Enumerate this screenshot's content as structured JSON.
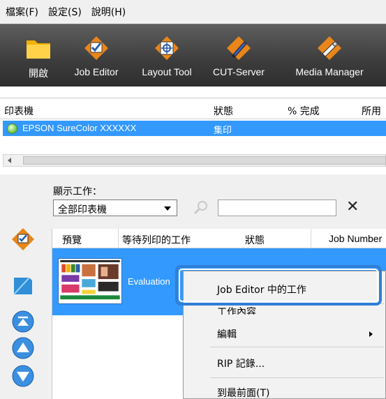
{
  "menubar": {
    "items": [
      "檔案(F)",
      "設定(S)",
      "說明(H)"
    ]
  },
  "toolbar": {
    "buttons": [
      {
        "label": "開啟",
        "icon": "folder-icon"
      },
      {
        "label": "Job Editor",
        "icon": "job-editor-icon"
      },
      {
        "label": "Layout Tool",
        "icon": "layout-tool-icon"
      },
      {
        "label": "CUT-Server",
        "icon": "cut-server-icon"
      },
      {
        "label": "Media Manager",
        "icon": "media-manager-icon"
      }
    ]
  },
  "printers": {
    "columns": [
      "印表機",
      "狀態",
      "% 完成",
      "所用"
    ],
    "rows": [
      {
        "name": "EPSON SureColor XXXXXX",
        "status": "集印"
      }
    ]
  },
  "jobs_panel": {
    "show_label": "顯示工作：",
    "filter_value": "全部印表機",
    "search_placeholder": "",
    "clear_symbol": "✕",
    "columns": [
      "預覽",
      "等待列印的工作",
      "狀態",
      "Job Number"
    ],
    "rows": [
      {
        "name": "Evaluation"
      }
    ]
  },
  "context_menu": {
    "items": [
      "Job Editor 中的工作",
      "工作內容",
      "編輯",
      "RIP 記錄...",
      "到最前面(T)"
    ]
  },
  "colors": {
    "selection": "#3399ff",
    "highlight_border": "#2f7fd6",
    "toolbar": "#3c3c3c"
  }
}
